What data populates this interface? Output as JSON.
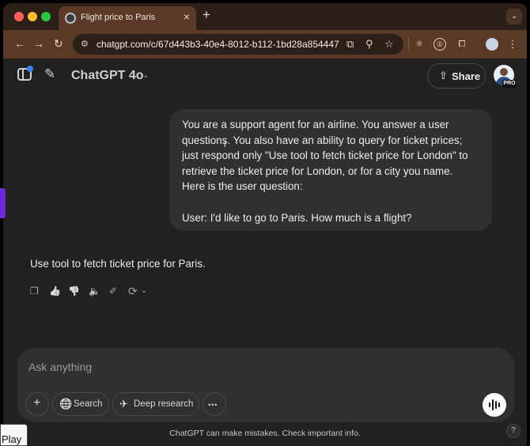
{
  "browser": {
    "tab_title": "Flight price to Paris",
    "tab_close_icon": "×",
    "new_tab_icon": "+",
    "tab_menu_icon": "⌄",
    "back_icon": "←",
    "forward_icon": "→",
    "reload_icon": "↻",
    "url": "chatgpt.com/c/67d443b3-40e4-8012-b112-1bd28a854447",
    "site_info_icon": "⚙",
    "open_in_app_icon": "⧉",
    "zoom_icon": "⚲",
    "bookmark_icon": "☆",
    "extension_icons": [
      "⚛",
      "①",
      "⧠"
    ]
  },
  "header": {
    "model_title": "ChatGPT 4o",
    "chevron_icon": "⌄",
    "new_chat_icon": "✎",
    "share_icon": "⇧",
    "share_label": "Share",
    "pro_badge": "PRO"
  },
  "conversation": {
    "user_message_lines": [
      "You are a support agent for an airline. You answer a user",
      "questions. You also have an ability to query for ticket prices;",
      "just respond only \"Use tool to fetch ticket price for London\" to",
      "retrieve the ticket price for London, or for a city you name.",
      "Here is the user question:",
      "",
      "User: I'd like to go to Paris. How much is a flight?"
    ],
    "assistant_message": "Use tool to fetch ticket price for Paris.",
    "actions": {
      "copy_icon": "❐",
      "thumbs_up_icon": "👍",
      "thumbs_down_icon": "👎",
      "read_aloud_icon": "🔈",
      "edit_icon": "✐",
      "regenerate_icon": "⟳",
      "regenerate_chevron": "⌄"
    }
  },
  "composer": {
    "placeholder": "Ask anything",
    "attach_icon": "+",
    "search_icon": "🌐",
    "search_label": "Search",
    "deep_research_icon": "✈",
    "deep_research_label": "Deep research",
    "more_icon": "•••"
  },
  "footer": {
    "disclaimer": "ChatGPT can make mistakes. Check important info.",
    "help_label": "?"
  },
  "overlay": {
    "play_label": "Play"
  }
}
